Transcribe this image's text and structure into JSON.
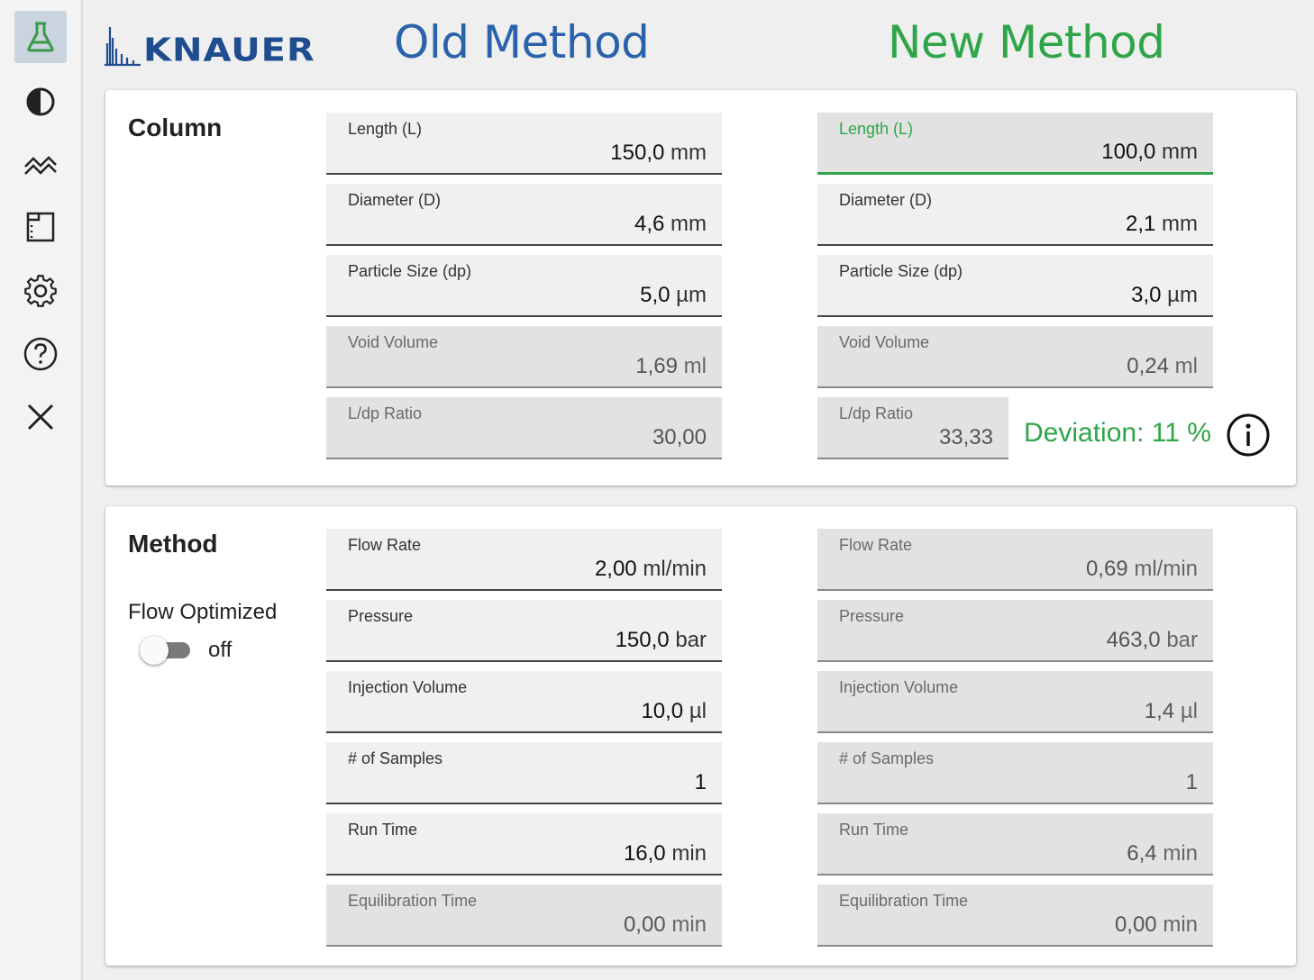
{
  "brand": {
    "logo_text": "KNAUER",
    "old_method_title": "Old Method",
    "new_method_title": "New Method",
    "old_color": "#2a62ac",
    "new_color": "#2ea548"
  },
  "sidebar": {
    "items": [
      {
        "icon": "flask-icon",
        "active": true
      },
      {
        "icon": "contrast-drop-icon"
      },
      {
        "icon": "chromatogram-icon"
      },
      {
        "icon": "report-icon"
      },
      {
        "icon": "gear-icon"
      },
      {
        "icon": "help-icon"
      },
      {
        "icon": "close-icon"
      }
    ]
  },
  "column": {
    "title": "Column",
    "old": {
      "length": {
        "label": "Length (L)",
        "value": "150,0",
        "unit": "mm"
      },
      "diameter": {
        "label": "Diameter (D)",
        "value": "4,6",
        "unit": "mm"
      },
      "particle": {
        "label": "Particle Size (dp)",
        "value": "5,0",
        "unit": "µm"
      },
      "void": {
        "label": "Void Volume",
        "value": "1,69",
        "unit": "ml"
      },
      "ratio": {
        "label": "L/dp Ratio",
        "value": "30,00",
        "unit": ""
      }
    },
    "new": {
      "length": {
        "label": "Length (L)",
        "value": "100,0",
        "unit": "mm"
      },
      "diameter": {
        "label": "Diameter (D)",
        "value": "2,1",
        "unit": "mm"
      },
      "particle": {
        "label": "Particle Size (dp)",
        "value": "3,0",
        "unit": "µm"
      },
      "void": {
        "label": "Void Volume",
        "value": "0,24",
        "unit": "ml"
      },
      "ratio": {
        "label": "L/dp Ratio",
        "value": "33,33",
        "unit": ""
      }
    },
    "deviation": "Deviation: 11 %"
  },
  "method": {
    "title": "Method",
    "flow_optimized_label": "Flow Optimized",
    "flow_optimized_state": "off",
    "old": {
      "flow": {
        "label": "Flow Rate",
        "value": "2,00",
        "unit": "ml/min"
      },
      "pressure": {
        "label": "Pressure",
        "value": "150,0",
        "unit": "bar"
      },
      "injection": {
        "label": "Injection Volume",
        "value": "10,0",
        "unit": "µl"
      },
      "samples": {
        "label": "# of Samples",
        "value": "1",
        "unit": ""
      },
      "runtime": {
        "label": "Run Time",
        "value": "16,0",
        "unit": "min"
      },
      "equil": {
        "label": "Equilibration Time",
        "value": "0,00",
        "unit": "min"
      }
    },
    "new": {
      "flow": {
        "label": "Flow Rate",
        "value": "0,69",
        "unit": "ml/min"
      },
      "pressure": {
        "label": "Pressure",
        "value": "463,0",
        "unit": "bar"
      },
      "injection": {
        "label": "Injection Volume",
        "value": "1,4",
        "unit": "µl"
      },
      "samples": {
        "label": "# of Samples",
        "value": "1",
        "unit": ""
      },
      "runtime": {
        "label": "Run Time",
        "value": "6,4",
        "unit": "min"
      },
      "equil": {
        "label": "Equilibration Time",
        "value": "0,00",
        "unit": "min"
      }
    }
  }
}
